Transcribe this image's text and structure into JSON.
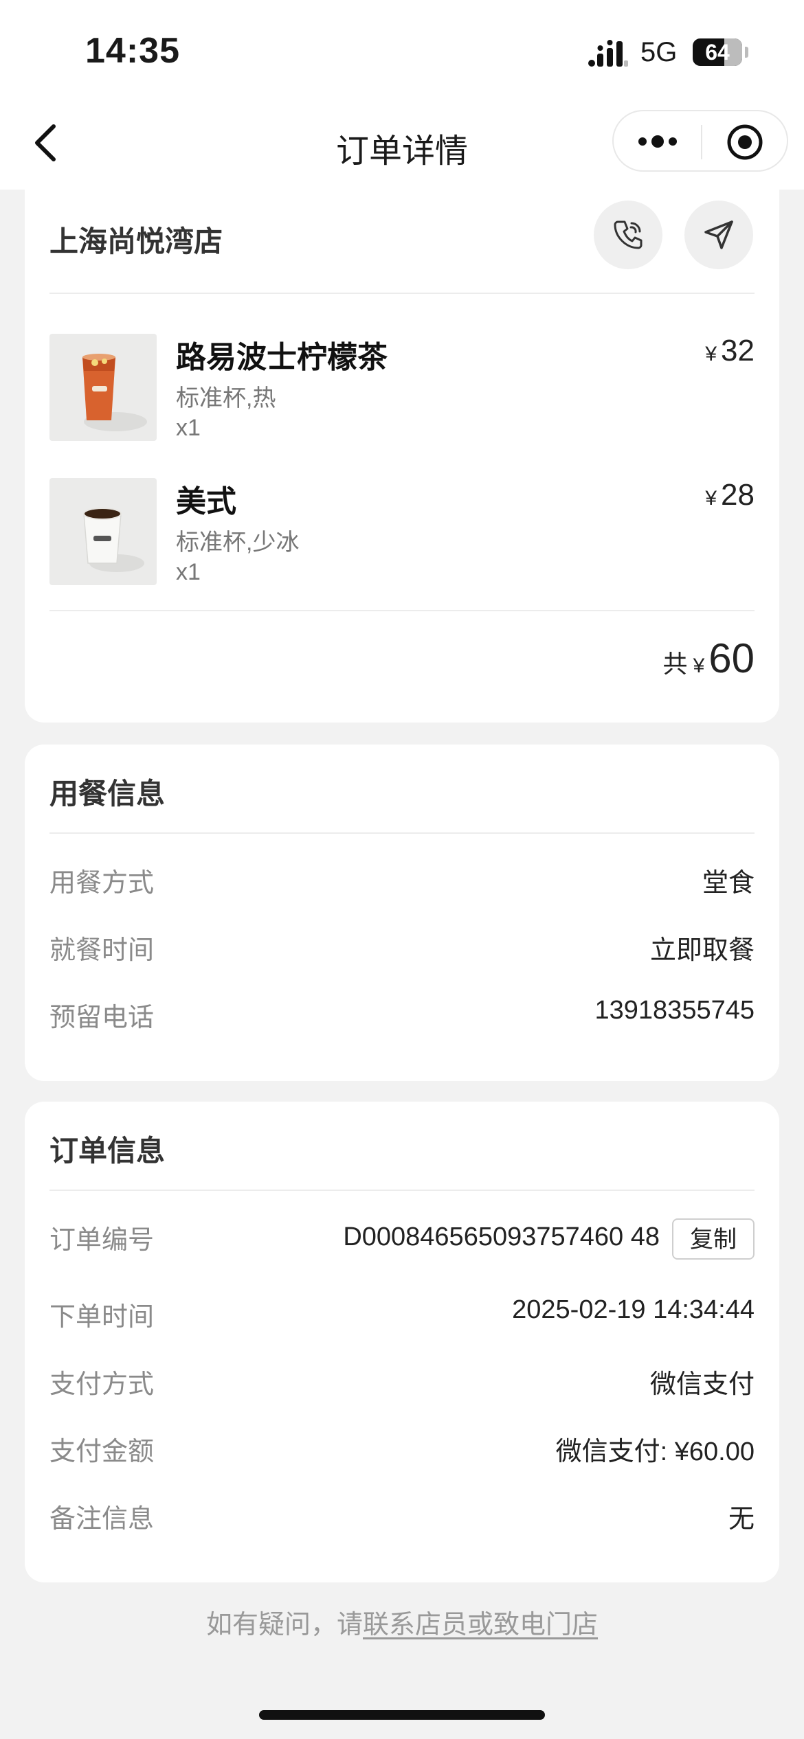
{
  "status_bar": {
    "time": "14:35",
    "network": "5G",
    "battery": "64",
    "battery_level": 0.64
  },
  "nav": {
    "title": "订单详情",
    "back_icon": "chevron-left-icon",
    "more_icon": "more-dots-icon",
    "close_icon": "target-icon"
  },
  "store": {
    "name": "上海尚悦湾店",
    "phone_icon": "phone-icon",
    "navigate_icon": "navigate-arrow-icon",
    "items": [
      {
        "name": "路易波士柠檬茶",
        "spec": "标准杯,热",
        "qty": "x1",
        "currency": "¥",
        "price": "32"
      },
      {
        "name": "美式",
        "spec": "标准杯,少冰",
        "qty": "x1",
        "currency": "¥",
        "price": "28"
      }
    ],
    "total_label": "共",
    "total_currency": "¥",
    "total_amount": "60"
  },
  "dining": {
    "title": "用餐信息",
    "rows": [
      {
        "label": "用餐方式",
        "value": "堂食"
      },
      {
        "label": "就餐时间",
        "value": "立即取餐"
      },
      {
        "label": "预留电话",
        "value": "13918355745"
      }
    ]
  },
  "order": {
    "title": "订单信息",
    "rows": [
      {
        "label": "订单编号",
        "value": "D000846565093757460 48"
      },
      {
        "label": "下单时间",
        "value": "2025-02-19 14:34:44"
      },
      {
        "label": "支付方式",
        "value": "微信支付"
      },
      {
        "label": "支付金额",
        "value": "微信支付: ¥60.00"
      },
      {
        "label": "备注信息",
        "value": "无"
      }
    ],
    "copy_label": "复制"
  },
  "footer": {
    "prefix": "如有疑问，请",
    "link": "联系店员或致电门店"
  },
  "colors": {
    "background": "#f2f2f2",
    "card": "#ffffff",
    "muted_text": "#8a8a8a"
  }
}
